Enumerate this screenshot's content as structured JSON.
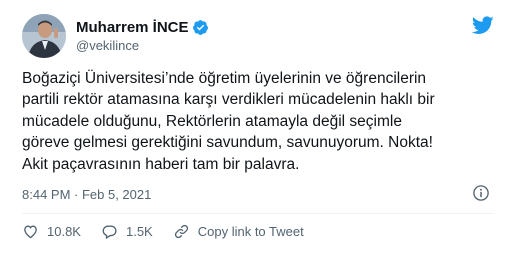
{
  "tweet": {
    "author_name": "Muharrem İNCE",
    "author_handle": "@vekilince",
    "text": "Boğaziçi Üniversitesi’nde öğretim üyelerinin ve öğrencilerin\npartili rektör atamasına karşı verdikleri mücadelenin haklı bir\nmücadele olduğunu, Rektörlerin atamayla değil seçimle\ngöreve gelmesi gerektiğini savundum, savunuyorum. Nokta!\nAkit paçavrasının haberi tam bir palavra.",
    "timestamp": "8:44 PM · Feb 5, 2021"
  },
  "actions": {
    "likes": "10.8K",
    "replies": "1.5K",
    "copy_label": "Copy link to Tweet"
  },
  "icons": {
    "verified": "verified-badge-icon",
    "twitter": "twitter-bird-icon",
    "info": "info-icon",
    "like": "heart-icon",
    "reply": "reply-bubble-icon",
    "copy": "link-icon"
  },
  "colors": {
    "twitter_blue": "#1d9bf0",
    "text_primary": "#0f1419",
    "text_secondary": "#536471"
  }
}
